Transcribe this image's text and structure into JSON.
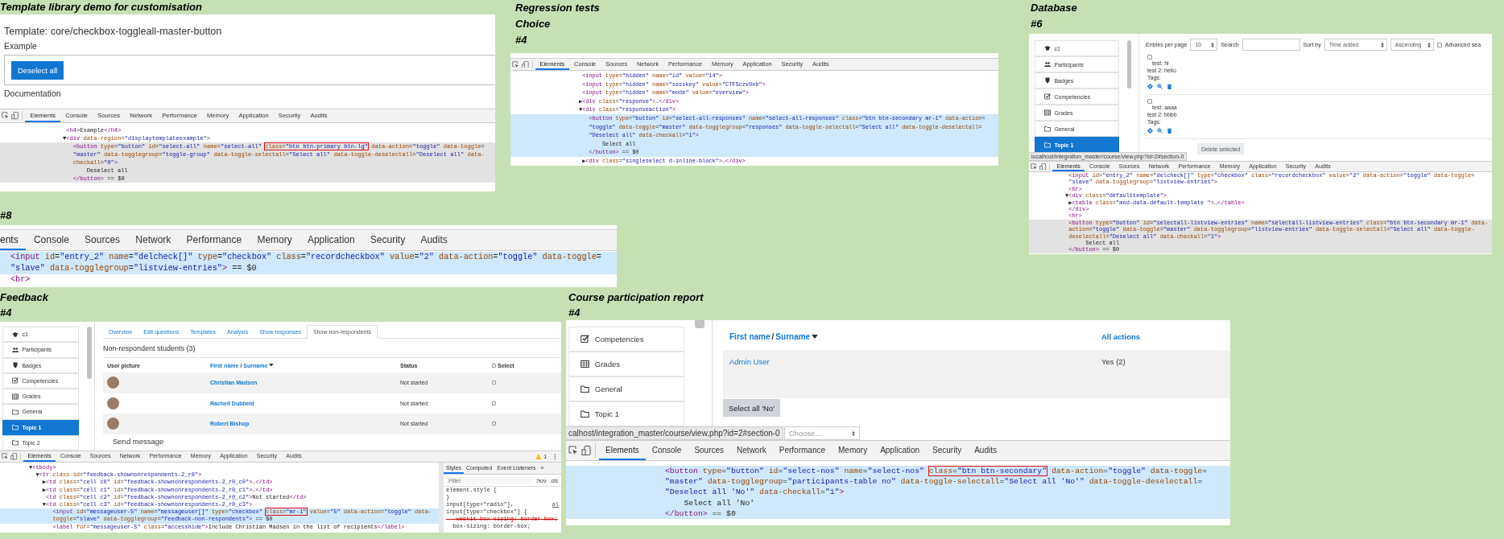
{
  "panels": [
    {
      "kind": "template",
      "captions": [
        "Template library demo for customisation"
      ],
      "page": {
        "heading": "Template: core/checkbox-toggleall-master-button",
        "section": "Example",
        "button": "Deselect all",
        "footer": "Documentation"
      },
      "devtools": {
        "focused": false,
        "tabs": [
          {
            "label": "Elements",
            "selected": true
          },
          {
            "label": "Console",
            "selected": false
          },
          {
            "label": "Sources",
            "selected": false
          },
          {
            "label": "Network",
            "selected": false
          },
          {
            "label": "Performance",
            "selected": false
          },
          {
            "label": "Memory",
            "selected": false
          },
          {
            "label": "Application",
            "selected": false
          },
          {
            "label": "Security",
            "selected": false
          },
          {
            "label": "Audits",
            "selected": false
          }
        ],
        "lines": [
          {
            "text": " <h4>Example</h4>",
            "selected": false
          },
          {
            "text": "▼<div data-region=\"displaytemplateexample\">",
            "selected": false
          },
          {
            "segments": [
              {
                "text": "   <button type=\"button\" id=\"select-all\" name=\"select-all\" ",
                "boxed": false
              },
              {
                "text": "class=\"btn btn-primary btn-lg\"",
                "boxed": true
              },
              {
                "text": " data-action=\"toggle\" data-toggle=",
                "boxed": false
              }
            ],
            "selected": true
          },
          {
            "text": "   \"master\" data-togglegroup=\"toggle-group\" data-toggle-selectall=\"Select all\" data-toggle-deselectall=\"Deselect all\" data-",
            "selected": true
          },
          {
            "text": "   checkall=\"0\">",
            "selected": true
          },
          {
            "text": "       Deselect all",
            "selected": true
          },
          {
            "text": "   </button> == $0",
            "selected": true
          }
        ]
      }
    },
    {
      "kind": "devtools",
      "captions": [
        "Regression tests",
        "Choice",
        "#4"
      ],
      "devtools": {
        "focused": true,
        "tabs": [
          {
            "label": "Elements",
            "selected": true
          },
          {
            "label": "Console",
            "selected": false
          },
          {
            "label": "Sources",
            "selected": false
          },
          {
            "label": "Network",
            "selected": false
          },
          {
            "label": "Performance",
            "selected": false
          },
          {
            "label": "Memory",
            "selected": false
          },
          {
            "label": "Application",
            "selected": false
          },
          {
            "label": "Security",
            "selected": false
          },
          {
            "label": "Audits",
            "selected": false
          }
        ],
        "lines": [
          {
            "text": " <input type=\"hidden\" name=\"id\" value=\"14\">",
            "selected": false
          },
          {
            "text": " <input type=\"hidden\" name=\"sesskey\" value=\"CTFSczv0xb\">",
            "selected": false
          },
          {
            "text": " <input type=\"hidden\" name=\"mode\" value=\"overview\">",
            "selected": false
          },
          {
            "text": "▶<div class=\"response\">…</div>",
            "selected": false
          },
          {
            "text": "▼<div class=\"responseaction\">",
            "selected": false
          },
          {
            "text": "   <button type=\"button\" id=\"select-all-responses\" name=\"select-all-responses\" class=\"btn btn-secondary mr-1\" data-action=",
            "selected": true
          },
          {
            "text": "   \"toggle\" data-toggle=\"master\" data-togglegroup=\"responses\" data-toggle-selectall=\"Select all\" data-toggle-deselectall=",
            "selected": true
          },
          {
            "text": "   \"Deselect all\" data-checkall=\"1\">",
            "selected": true
          },
          {
            "text": "       Select all",
            "selected": true
          },
          {
            "text": "   </button> == $0",
            "selected": true
          },
          {
            "text": " ▶<div class=\"singleselect d-inline-block\">…</div>",
            "selected": false
          }
        ]
      }
    },
    {
      "kind": "database",
      "captions": [
        "Database",
        "#6"
      ],
      "page": {
        "nav": [
          {
            "kind": "cap",
            "label": "c1",
            "selected": false
          },
          {
            "kind": "people",
            "label": "Participants",
            "selected": false
          },
          {
            "kind": "shield",
            "label": "Badges",
            "selected": false
          },
          {
            "kind": "check",
            "label": "Competencies",
            "selected": false
          },
          {
            "kind": "grid",
            "label": "Grades",
            "selected": false
          },
          {
            "kind": "folder",
            "label": "General",
            "selected": false
          },
          {
            "kind": "folder",
            "label": "Topic 1",
            "selected": true
          }
        ],
        "entries_label": "Entries per page",
        "entries_value": "10",
        "search_label": "Search",
        "sort_label": "Sort by",
        "sort_value": "Time added",
        "order_value": "Ascending",
        "advanced": {
          "label": "Advanced sea",
          "checked": false
        },
        "entries": [
          {
            "checked": false,
            "fields": [
              "test: hi",
              "test 2: hello"
            ],
            "tags": "Tags:"
          },
          {
            "checked": false,
            "fields": [
              "test: aaaa",
              "test 2: bbbb"
            ],
            "tags": "Tags:"
          }
        ],
        "delete_button": "Delete selected",
        "status_url": "localhost/integration_master/course/view.php?id=2#section-0"
      },
      "devtools": {
        "focused": false,
        "tabs": [
          {
            "label": "Elements",
            "selected": true
          },
          {
            "label": "Console",
            "selected": false
          },
          {
            "label": "Sources",
            "selected": false
          },
          {
            "label": "Network",
            "selected": false
          },
          {
            "label": "Performance",
            "selected": false
          },
          {
            "label": "Memory",
            "selected": false
          },
          {
            "label": "Application",
            "selected": false
          },
          {
            "label": "Security",
            "selected": false
          },
          {
            "label": "Audits",
            "selected": false
          }
        ],
        "lines": [
          {
            "text": " <input id=\"entry_2\" name=\"delcheck[]\" type=\"checkbox\" class=\"recordcheckbox\" value=\"2\" data-action=\"toggle\" data-toggle=",
            "selected": false
          },
          {
            "text": " \"slave\" data-togglegroup=\"listview-entries\">",
            "selected": false
          },
          {
            "text": " <br>",
            "selected": false
          },
          {
            "text": "▼<div class=\"defaulttemplate\">",
            "selected": false
          },
          {
            "text": " ▶<table class=\"mod-data-default-template \">…</table>",
            "selected": false
          },
          {
            "text": " </div>",
            "selected": false
          },
          {
            "text": " <hr>",
            "selected": false
          },
          {
            "text": " <button type=\"button\" id=\"selectall-listview-entries\" name=\"selectall-listview-entries\" class=\"btn btn-secondary mr-1\" data-",
            "selected": true
          },
          {
            "text": " action=\"toggle\" data-toggle=\"master\" data-togglegroup=\"listview-entries\" data-toggle-selectall=\"Select all\" data-toggle-",
            "selected": true
          },
          {
            "text": " deselectall=\"Deselect all\" data-checkall=\"1\">",
            "selected": true
          },
          {
            "text": "      Select all",
            "selected": true
          },
          {
            "text": " </button> == $0",
            "selected": true
          }
        ]
      }
    },
    {
      "kind": "devtools",
      "captions": [
        "#8"
      ],
      "devtools": {
        "focused": true,
        "tabs": [
          {
            "label": "ents",
            "selected": true
          },
          {
            "label": "Console",
            "selected": false
          },
          {
            "label": "Sources",
            "selected": false
          },
          {
            "label": "Network",
            "selected": false
          },
          {
            "label": "Performance",
            "selected": false
          },
          {
            "label": "Memory",
            "selected": false
          },
          {
            "label": "Application",
            "selected": false
          },
          {
            "label": "Security",
            "selected": false
          },
          {
            "label": "Audits",
            "selected": false
          }
        ],
        "lines": [
          {
            "text": "<input id=\"entry_2\" name=\"delcheck[]\" type=\"checkbox\" class=\"recordcheckbox\" value=\"2\" data-action=\"toggle\" data-toggle=",
            "selected": true
          },
          {
            "text": "\"slave\" data-togglegroup=\"listview-entries\"> == $0",
            "selected": true
          },
          {
            "text": "<br>",
            "selected": false
          }
        ]
      }
    },
    {
      "kind": "feedback",
      "captions": [
        "Feedback",
        "#4"
      ],
      "page": {
        "nav": [
          {
            "kind": "cap",
            "label": "c1",
            "selected": false
          },
          {
            "kind": "people",
            "label": "Participants",
            "selected": false
          },
          {
            "kind": "shield",
            "label": "Badges",
            "selected": false
          },
          {
            "kind": "check",
            "label": "Competencies",
            "selected": false
          },
          {
            "kind": "grid",
            "label": "Grades",
            "selected": false
          },
          {
            "kind": "folder",
            "label": "General",
            "selected": false
          },
          {
            "kind": "folder",
            "label": "Topic 1",
            "selected": true
          },
          {
            "kind": "folder",
            "label": "Topic 2",
            "selected": false
          }
        ],
        "tabs": [
          {
            "label": "Overview",
            "selected": false
          },
          {
            "label": "Edit questions",
            "selected": false
          },
          {
            "label": "Templates",
            "selected": false
          },
          {
            "label": "Analysis",
            "selected": false
          },
          {
            "label": "Show responses",
            "selected": false
          },
          {
            "label": "Show non-respondents",
            "selected": true
          }
        ],
        "heading": "Non-respondent students (3)",
        "columns": {
          "picture": "User picture",
          "first": "First name",
          "sep": "/",
          "last": "Surname",
          "status": "Status",
          "select": "Select"
        },
        "select_all_checked": false,
        "rows": [
          {
            "name": "Christian Madsen",
            "status": "Not started",
            "checked": false
          },
          {
            "name": "Rachell Dubbeld",
            "status": "Not started",
            "checked": false
          },
          {
            "name": "Robert Bishop",
            "status": "Not started",
            "checked": false
          }
        ],
        "send_message": "Send message"
      },
      "devtools": {
        "focused": true,
        "warning": "1",
        "tabs": [
          {
            "label": "Elements",
            "selected": true
          },
          {
            "label": "Console",
            "selected": false
          },
          {
            "label": "Sources",
            "selected": false
          },
          {
            "label": "Network",
            "selected": false
          },
          {
            "label": "Performance",
            "selected": false
          },
          {
            "label": "Memory",
            "selected": false
          },
          {
            "label": "Application",
            "selected": false
          },
          {
            "label": "Security",
            "selected": false
          },
          {
            "label": "Audits",
            "selected": false
          }
        ],
        "lines": [
          {
            "text": "▼<tbody>",
            "selected": false
          },
          {
            "text": "  ▼<tr class id=\"feedback-shownonrespondents-2_r0\">",
            "selected": false
          },
          {
            "text": "    ▶<td class=\"cell c0\" id=\"feedback-shownonrespondents-2_r0_c0\">…</td>",
            "selected": false
          },
          {
            "text": "    ▶<td class=\"cell c1\" id=\"feedback-shownonrespondents-2_r0_c1\">…</td>",
            "selected": false
          },
          {
            "text": "     <td class=\"cell c2\" id=\"feedback-shownonrespondents-2_r0_c2\">Not started</td>",
            "selected": false
          },
          {
            "text": "    ▼<td class=\"cell c3\" id=\"feedback-shownonrespondents-2_r0_c3\">",
            "selected": false
          },
          {
            "segments": [
              {
                "text": "       <input id=\"messageuser-5\" name=\"messageuser[]\" type=\"checkbox\" ",
                "boxed": false
              },
              {
                "text": "class=\"mr-1\"",
                "boxed": true
              },
              {
                "text": " value=\"5\" data-action=\"toggle\" data-",
                "boxed": false
              }
            ],
            "selected": true
          },
          {
            "text": "       toggle=\"slave\" data-togglegroup=\"feedback-non-respondents\"> == $0",
            "selected": true
          },
          {
            "text": "       <label for=\"messageuser-5\" class=\"accesshide\">Include Christian Madsen in the list of recipients</label>",
            "selected": false
          }
        ],
        "styles": {
          "tabs": [
            {
              "label": "Styles",
              "selected": true
            },
            {
              "label": "Computed",
              "selected": false
            },
            {
              "label": "Event Listeners",
              "selected": false
            }
          ],
          "more": "»",
          "placeholder": "Filter",
          "hov": ":hov",
          "cls": ".cls",
          "rules": [
            {
              "text": "element.style {",
              "struck": false
            },
            {
              "text": "}",
              "struck": false
            },
            {
              "text": "input[type=\"radio\"],",
              "struck": false,
              "link": "al"
            },
            {
              "text": "input[type=\"checkbox\"] {",
              "struck": false
            },
            {
              "text": "  -webkit-box-sizing: border-box;",
              "struck": true
            },
            {
              "text": "  box-sizing: border-box;",
              "struck": false
            }
          ]
        }
      }
    },
    {
      "kind": "participation",
      "captions": [
        "Course participation report",
        "#4"
      ],
      "page": {
        "nav": [
          {
            "kind": "check",
            "label": "Competencies",
            "selected": false
          },
          {
            "kind": "grid",
            "label": "Grades",
            "selected": false
          },
          {
            "kind": "folder",
            "label": "General",
            "selected": false
          },
          {
            "kind": "folder",
            "label": "Topic 1",
            "selected": false
          }
        ],
        "header": {
          "first": "First name",
          "sep": "/",
          "last": "Surname",
          "actions": "All actions"
        },
        "rows": [
          {
            "name": "Admin User",
            "actions": "Yes (2)"
          }
        ],
        "button": "Select all 'No'",
        "status_url": "calhost/integration_master/course/view.php?id=2#section-0",
        "select_placeholder": "Choose..."
      },
      "devtools": {
        "focused": true,
        "tabs": [
          {
            "label": "Elements",
            "selected": true
          },
          {
            "label": "Console",
            "selected": false
          },
          {
            "label": "Sources",
            "selected": false
          },
          {
            "label": "Network",
            "selected": false
          },
          {
            "label": "Performance",
            "selected": false
          },
          {
            "label": "Memory",
            "selected": false
          },
          {
            "label": "Application",
            "selected": false
          },
          {
            "label": "Security",
            "selected": false
          },
          {
            "label": "Audits",
            "selected": false
          }
        ],
        "lines": [
          {
            "segments": [
              {
                "text": "<button type=\"button\" id=\"select-nos\" name=\"select-nos\" ",
                "boxed": false
              },
              {
                "text": "class=\"btn btn-secondary\"",
                "boxed": true
              },
              {
                "text": " data-action=\"toggle\" data-toggle=",
                "boxed": false
              }
            ],
            "selected": true
          },
          {
            "text": "\"master\" data-togglegroup=\"participants-table no\" data-toggle-selectall=\"Select all 'No'\" data-toggle-deselectall=",
            "selected": true
          },
          {
            "text": "\"Deselect all 'No'\" data-checkall=\"1\">",
            "selected": true
          },
          {
            "text": "    Select all 'No'",
            "selected": true
          },
          {
            "text": "</button> == $0",
            "selected": true
          }
        ]
      }
    }
  ]
}
